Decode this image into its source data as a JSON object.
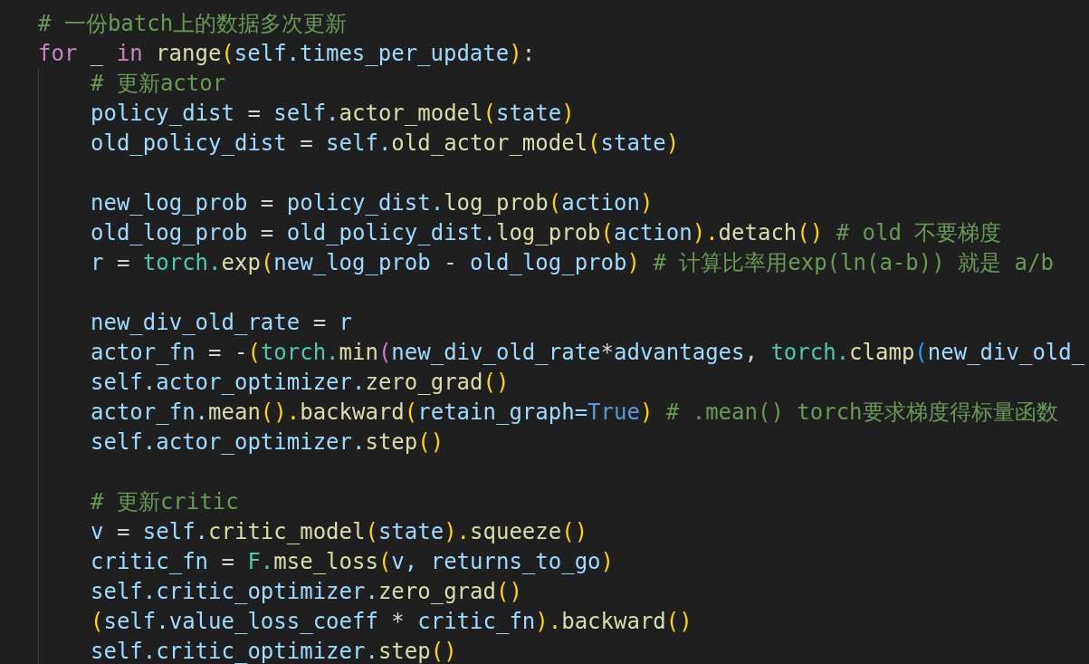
{
  "editor": {
    "lines": [
      {
        "kind": "code",
        "tokens": [
          {
            "kind": "cmt",
            "text": "# 一份batch上的数据多次更新"
          }
        ]
      },
      {
        "kind": "code",
        "tokens": [
          {
            "kind": "kw",
            "text": "for"
          },
          {
            "kind": "op",
            "text": " _ "
          },
          {
            "kind": "kw",
            "text": "in "
          },
          {
            "kind": "fn",
            "text": "range"
          },
          {
            "kind": "b1",
            "text": "("
          },
          {
            "kind": "var",
            "text": "self."
          },
          {
            "kind": "var",
            "text": "times_per_update"
          },
          {
            "kind": "b1",
            "text": ")"
          },
          {
            "kind": "op",
            "text": ":"
          }
        ],
        "children": [
          {
            "kind": "code",
            "tokens": [
              {
                "kind": "cmt",
                "text": "# 更新actor"
              }
            ]
          },
          {
            "kind": "code",
            "tokens": [
              {
                "kind": "var",
                "text": "policy_dist"
              },
              {
                "kind": "op",
                "text": " = "
              },
              {
                "kind": "var",
                "text": "self."
              },
              {
                "kind": "fn",
                "text": "actor_model"
              },
              {
                "kind": "b1",
                "text": "("
              },
              {
                "kind": "var",
                "text": "state"
              },
              {
                "kind": "b1",
                "text": ")"
              }
            ]
          },
          {
            "kind": "code",
            "tokens": [
              {
                "kind": "var",
                "text": "old_policy_dist"
              },
              {
                "kind": "op",
                "text": " = "
              },
              {
                "kind": "var",
                "text": "self."
              },
              {
                "kind": "fn",
                "text": "old_actor_model"
              },
              {
                "kind": "b1",
                "text": "("
              },
              {
                "kind": "var",
                "text": "state"
              },
              {
                "kind": "b1",
                "text": ")"
              }
            ]
          },
          {
            "kind": "blank"
          },
          {
            "kind": "code",
            "tokens": [
              {
                "kind": "var",
                "text": "new_log_prob"
              },
              {
                "kind": "op",
                "text": " = "
              },
              {
                "kind": "var",
                "text": "policy_dist."
              },
              {
                "kind": "fn",
                "text": "log_prob"
              },
              {
                "kind": "b1",
                "text": "("
              },
              {
                "kind": "var",
                "text": "action"
              },
              {
                "kind": "b1",
                "text": ")"
              }
            ]
          },
          {
            "kind": "code",
            "tokens": [
              {
                "kind": "var",
                "text": "old_log_prob"
              },
              {
                "kind": "op",
                "text": " = "
              },
              {
                "kind": "var",
                "text": "old_policy_dist."
              },
              {
                "kind": "fn",
                "text": "log_prob"
              },
              {
                "kind": "b1",
                "text": "("
              },
              {
                "kind": "var",
                "text": "action"
              },
              {
                "kind": "b1",
                "text": ")."
              },
              {
                "kind": "fn",
                "text": "detach"
              },
              {
                "kind": "b1",
                "text": "() "
              },
              {
                "kind": "cmt",
                "text": "# old 不要梯度"
              }
            ]
          },
          {
            "kind": "code",
            "tokens": [
              {
                "kind": "var",
                "text": "r"
              },
              {
                "kind": "op",
                "text": " = "
              },
              {
                "kind": "cls",
                "text": "torch."
              },
              {
                "kind": "fn",
                "text": "exp"
              },
              {
                "kind": "b1",
                "text": "("
              },
              {
                "kind": "var",
                "text": "new_log_prob"
              },
              {
                "kind": "op",
                "text": " - "
              },
              {
                "kind": "var",
                "text": "old_log_prob"
              },
              {
                "kind": "b1",
                "text": ") "
              },
              {
                "kind": "cmt",
                "text": "# 计算比率用exp(ln(a-b)) 就是 a/b"
              }
            ]
          },
          {
            "kind": "blank"
          },
          {
            "kind": "code",
            "tokens": [
              {
                "kind": "var",
                "text": "new_div_old_rate"
              },
              {
                "kind": "op",
                "text": " = "
              },
              {
                "kind": "var",
                "text": "r"
              }
            ]
          },
          {
            "kind": "code",
            "tokens": [
              {
                "kind": "var",
                "text": "actor_fn"
              },
              {
                "kind": "op",
                "text": " = -"
              },
              {
                "kind": "b1",
                "text": "("
              },
              {
                "kind": "cls",
                "text": "torch."
              },
              {
                "kind": "fn",
                "text": "min"
              },
              {
                "kind": "b2",
                "text": "("
              },
              {
                "kind": "var",
                "text": "new_div_old_rate"
              },
              {
                "kind": "op",
                "text": "*"
              },
              {
                "kind": "var",
                "text": "advantages"
              },
              {
                "kind": "op",
                "text": ", "
              },
              {
                "kind": "cls",
                "text": "torch."
              },
              {
                "kind": "fn",
                "text": "clamp"
              },
              {
                "kind": "b3",
                "text": "("
              },
              {
                "kind": "var",
                "text": "new_div_old_"
              }
            ]
          },
          {
            "kind": "code",
            "tokens": [
              {
                "kind": "var",
                "text": "self.actor_optimizer."
              },
              {
                "kind": "fn",
                "text": "zero_grad"
              },
              {
                "kind": "b1",
                "text": "()"
              }
            ]
          },
          {
            "kind": "code",
            "tokens": [
              {
                "kind": "var",
                "text": "actor_fn."
              },
              {
                "kind": "fn",
                "text": "mean"
              },
              {
                "kind": "b1",
                "text": "()."
              },
              {
                "kind": "fn",
                "text": "backward"
              },
              {
                "kind": "b1",
                "text": "("
              },
              {
                "kind": "var",
                "text": "retain_graph="
              },
              {
                "kind": "const",
                "text": "True"
              },
              {
                "kind": "b1",
                "text": ") "
              },
              {
                "kind": "cmt",
                "text": "# .mean() torch要求梯度得标量函数"
              }
            ]
          },
          {
            "kind": "code",
            "tokens": [
              {
                "kind": "var",
                "text": "self.actor_optimizer."
              },
              {
                "kind": "fn",
                "text": "step"
              },
              {
                "kind": "b1",
                "text": "()"
              }
            ]
          },
          {
            "kind": "blank"
          },
          {
            "kind": "code",
            "tokens": [
              {
                "kind": "cmt",
                "text": "# 更新critic"
              }
            ]
          },
          {
            "kind": "code",
            "tokens": [
              {
                "kind": "var",
                "text": "v"
              },
              {
                "kind": "op",
                "text": " = "
              },
              {
                "kind": "var",
                "text": "self."
              },
              {
                "kind": "fn",
                "text": "critic_model"
              },
              {
                "kind": "b1",
                "text": "("
              },
              {
                "kind": "var",
                "text": "state"
              },
              {
                "kind": "b1",
                "text": ")."
              },
              {
                "kind": "fn",
                "text": "squeeze"
              },
              {
                "kind": "b1",
                "text": "()"
              }
            ]
          },
          {
            "kind": "code",
            "tokens": [
              {
                "kind": "var",
                "text": "critic_fn"
              },
              {
                "kind": "op",
                "text": " = "
              },
              {
                "kind": "cls",
                "text": "F."
              },
              {
                "kind": "fn",
                "text": "mse_loss"
              },
              {
                "kind": "b1",
                "text": "("
              },
              {
                "kind": "var",
                "text": "v, returns_to_go"
              },
              {
                "kind": "b1",
                "text": ")"
              }
            ]
          },
          {
            "kind": "code",
            "tokens": [
              {
                "kind": "var",
                "text": "self.critic_optimizer."
              },
              {
                "kind": "fn",
                "text": "zero_grad"
              },
              {
                "kind": "b1",
                "text": "()"
              }
            ]
          },
          {
            "kind": "code",
            "tokens": [
              {
                "kind": "b1",
                "text": "("
              },
              {
                "kind": "var",
                "text": "self.value_loss_coeff"
              },
              {
                "kind": "op",
                "text": " * "
              },
              {
                "kind": "var",
                "text": "critic_fn"
              },
              {
                "kind": "b1",
                "text": ")."
              },
              {
                "kind": "fn",
                "text": "backward"
              },
              {
                "kind": "b1",
                "text": "()"
              }
            ]
          },
          {
            "kind": "code",
            "tokens": [
              {
                "kind": "var",
                "text": "self.critic_optimizer."
              },
              {
                "kind": "fn",
                "text": "step"
              },
              {
                "kind": "b1",
                "text": "()"
              }
            ]
          }
        ]
      }
    ]
  }
}
